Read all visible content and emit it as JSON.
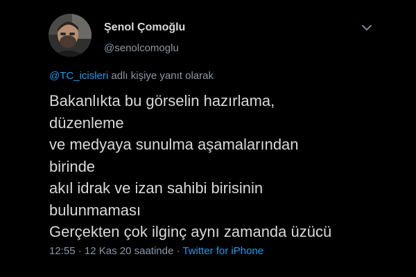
{
  "tweet": {
    "author": {
      "name": "Şenol Çomoğlu",
      "handle": "@senolcomoglu"
    },
    "reply": {
      "mention": "@TC_icisleri",
      "suffix": " adlı kişiye yanıt olarak"
    },
    "text_lines": [
      "Bakanlıkta bu görselin hazırlama,",
      "düzenleme",
      "ve medyaya sunulma aşamalarından",
      "birinde",
      "akıl idrak ve izan sahibi birisinin",
      "bulunmaması",
      "Gerçekten çok ilginç aynı zamanda üzücü"
    ],
    "meta": {
      "time": "12:55",
      "separator1": " · ",
      "date": "12 Kas 20 saatinde",
      "separator2": " · ",
      "source": "Twitter for iPhone"
    }
  },
  "icons": {
    "more": "chevron-down-icon"
  },
  "colors": {
    "background": "#000000",
    "text": "#d9d9d9",
    "secondary": "#8b98a5",
    "link": "#1d9bf0"
  }
}
